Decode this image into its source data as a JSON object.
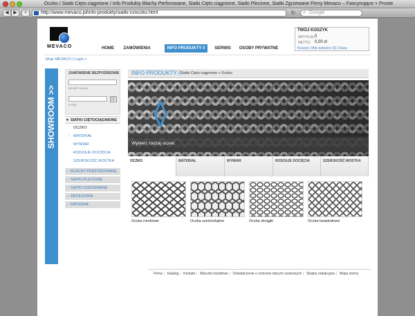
{
  "browser": {
    "window_title": "Oczko / Siatki Cięto ciągnione / Info Produkty Blachy Perforowane, Siatki Cięto ciągnione, Siatki Plecione, Siatki Zgrzewane Firmy Mevaco – Fascynujące + Proste",
    "url": "http://www.mevaco.pl/info-produkty/siatki-ci/oczko.html",
    "search_placeholder": "Google",
    "back": "◀",
    "forward": "▶",
    "add": "+",
    "reload": "↻"
  },
  "site": {
    "logo_text": "MEVACO",
    "brand_color": "#3e8fcd"
  },
  "mainnav": [
    {
      "label": "HOME"
    },
    {
      "label": "ZAMÓWIENIA"
    },
    {
      "label": "INFO PRODUKTY //",
      "active": true
    },
    {
      "label": "SERWIS"
    },
    {
      "label": "OSOBY PRYWATNE"
    }
  ],
  "cart": {
    "title": "TWÓJ KOSZYK",
    "articles_label": "ARTYKUŁ:",
    "articles_value": "0",
    "net_label": "NETTO:",
    "net_value": "0,00 zł",
    "links": "Koszyk | Mój wybrane (0) | Kasa"
  },
  "login_links": "Moje MEVACO | Login >",
  "showroom_label": "SHOWROOM >>",
  "orderbox": {
    "title": "ZAMÓWIENIE BEZPOŚREDNIE",
    "article_no_label": "NR ARTYKUŁU",
    "quantity_label": "ILOŚĆ",
    "cart_icon": "🛒"
  },
  "sidemenu": {
    "head": "SIATKI CIĘTOCIĄGNIONE",
    "selected": "OCZKO",
    "sub": [
      "MATERIAŁ",
      "WYMIAR",
      "RODZAJE DOCIĘCIA",
      "SZEROKOŚĆ MOSTKA"
    ],
    "categories": [
      "BLACHY PERFOROWANE",
      "SIATKI PLECIONE",
      "SIATKI ZGRZEWANE",
      "ARCESORIA",
      "MATERIAŁ"
    ]
  },
  "content": {
    "title": "INFO PRODUKTY //",
    "breadcrumb": "Siatki Cięto ciągnione  >  Oczko",
    "hero_caption": "Wybierz rodzaj oczek.",
    "tabs": [
      "OCZKO",
      "MATERIAŁ",
      "WYMIAR",
      "RODZAJE DOCIĘCIA",
      "SZEROKOŚĆ MOSTKA"
    ],
    "thumbs": [
      {
        "caption": "Oczka rombowe"
      },
      {
        "caption": "Oczka sześciokątne"
      },
      {
        "caption": "Oczka okrągłe"
      },
      {
        "caption": "Oczka kwadratowe"
      }
    ]
  },
  "footer": [
    "Firma",
    "Katalog",
    "Kontakt",
    "Warunki handlowe",
    "Oświadczenie o ochronie danych osobowych",
    "Stopka redakcyjna",
    "Mapa strony"
  ]
}
